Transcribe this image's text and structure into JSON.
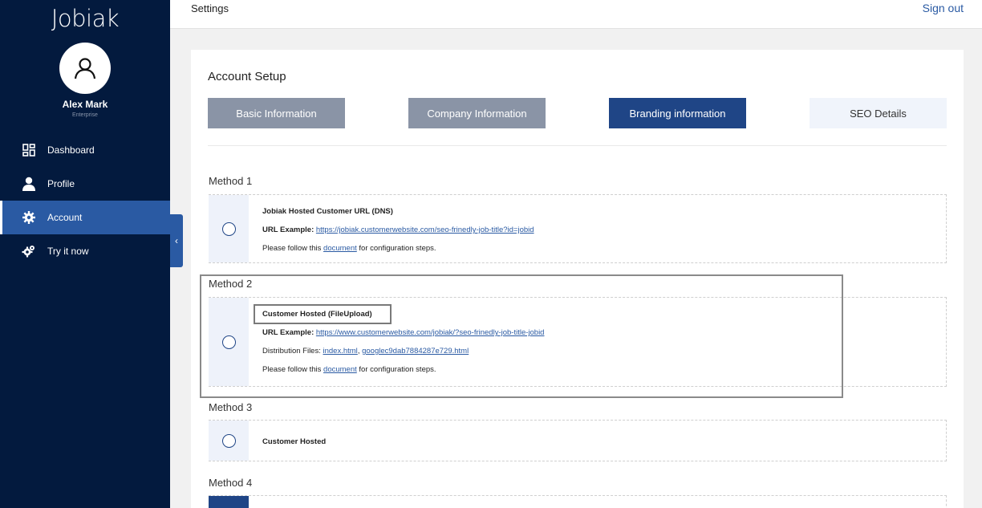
{
  "sidebar": {
    "logo": "Jobiak",
    "user_name": "Alex Mark",
    "user_role": "Enterprise",
    "items": [
      {
        "label": "Dashboard",
        "icon": "dashboard-icon"
      },
      {
        "label": "Profile",
        "icon": "user-icon"
      },
      {
        "label": "Account",
        "icon": "gear-icon",
        "active": true
      },
      {
        "label": "Try it now",
        "icon": "gears-icon"
      }
    ],
    "collapse_icon": "chevron-left-icon"
  },
  "header": {
    "title": "Settings",
    "signout": "Sign out"
  },
  "card": {
    "title": "Account Setup",
    "tabs": [
      {
        "label": "Basic Information"
      },
      {
        "label": "Company Information"
      },
      {
        "label": "Branding information",
        "active": true
      },
      {
        "label": "SEO Details"
      }
    ]
  },
  "methods": [
    {
      "label": "Method 1",
      "title": "Jobiak Hosted Customer URL (DNS)",
      "url_label": "URL Example:",
      "url": "https://jobiak.customerwebsite.com/seo-frinedly-job-title?id=jobid",
      "follow_pre": "Please follow this",
      "follow_link": "document",
      "follow_post": "for configuration steps."
    },
    {
      "label": "Method 2",
      "title": "Customer Hosted (FileUpload)",
      "url_label": "URL Example:",
      "url": "https://www.customerwebsite.com/jobiak/?seo-frinedly-job-title-jobid",
      "dist_label": "Distribution Files:",
      "dist_file1": "index.html",
      "dist_sep": ",",
      "dist_file2": "googlec9dab7884287e729.html",
      "follow_pre": "Please follow this",
      "follow_link": "document",
      "follow_post": "for configuration steps."
    },
    {
      "label": "Method 3",
      "title": "Customer Hosted"
    },
    {
      "label": "Method 4"
    }
  ],
  "colors": {
    "sidebar_bg": "#031a3e",
    "accent": "#1f4586",
    "link": "#2a5aa3"
  }
}
